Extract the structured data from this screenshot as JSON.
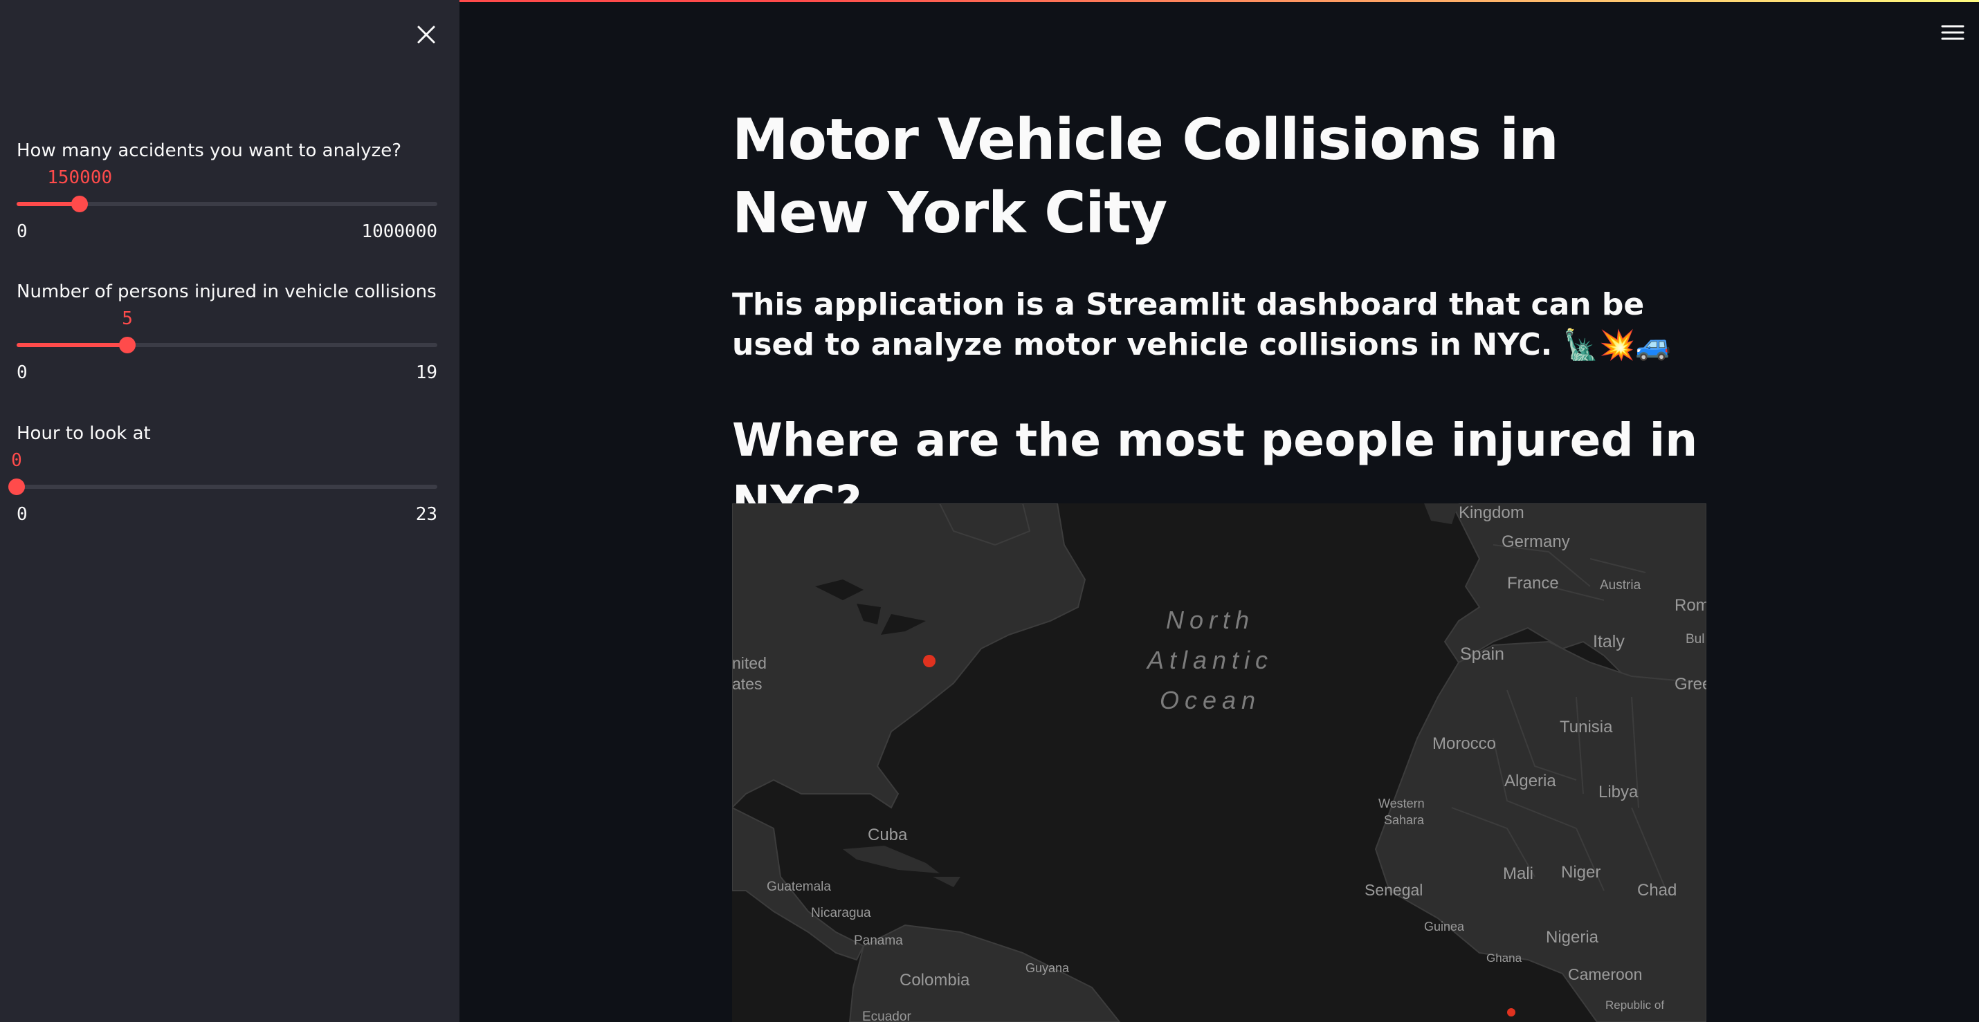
{
  "sidebar": {
    "close_icon": "close-icon",
    "sliders": [
      {
        "label": "How many accidents you want to analyze?",
        "value": "150000",
        "min": "0",
        "max": "1000000",
        "fraction": 0.15
      },
      {
        "label": "Number of persons injured in vehicle collisions",
        "value": "5",
        "min": "0",
        "max": "19",
        "fraction": 0.2632
      },
      {
        "label": "Hour to look at",
        "value": "0",
        "min": "0",
        "max": "23",
        "fraction": 0.0
      }
    ]
  },
  "header": {
    "menu_icon": "hamburger-menu-icon"
  },
  "main": {
    "title": "Motor Vehicle Collisions in New York City",
    "subtitle": "This application is a Streamlit dashboard that can be used to analyze motor vehicle collisions in NYC.",
    "subtitle_emojis": "🗽💥🚙",
    "section_heading": "Where are the most people injured in NYC?"
  },
  "map": {
    "ocean_label": [
      "North",
      "Atlantic",
      "Ocean"
    ],
    "labels": {
      "kingdom": "Kingdom",
      "germany": "Germany",
      "france": "France",
      "austria": "Austria",
      "rom": "Rom",
      "spain": "Spain",
      "italy": "Italy",
      "bul": "Bul",
      "gree": "Gree",
      "tunisia": "Tunisia",
      "morocco": "Morocco",
      "algeria": "Algeria",
      "libya": "Libya",
      "western": "Western",
      "sahara": "Sahara",
      "mali": "Mali",
      "niger": "Niger",
      "chad": "Chad",
      "senegal": "Senegal",
      "guinea": "Guinea",
      "nigeria": "Nigeria",
      "ghana": "Ghana",
      "cameroon": "Cameroon",
      "republic_of": "Republic of",
      "cuba": "Cuba",
      "guatemala": "Guatemala",
      "nicaragua": "Nicaragua",
      "panama": "Panama",
      "colombia": "Colombia",
      "guyana": "Guyana",
      "ecuador": "Ecuador",
      "united": "nited",
      "states": "ates"
    },
    "marker_color": "#e0321f"
  }
}
